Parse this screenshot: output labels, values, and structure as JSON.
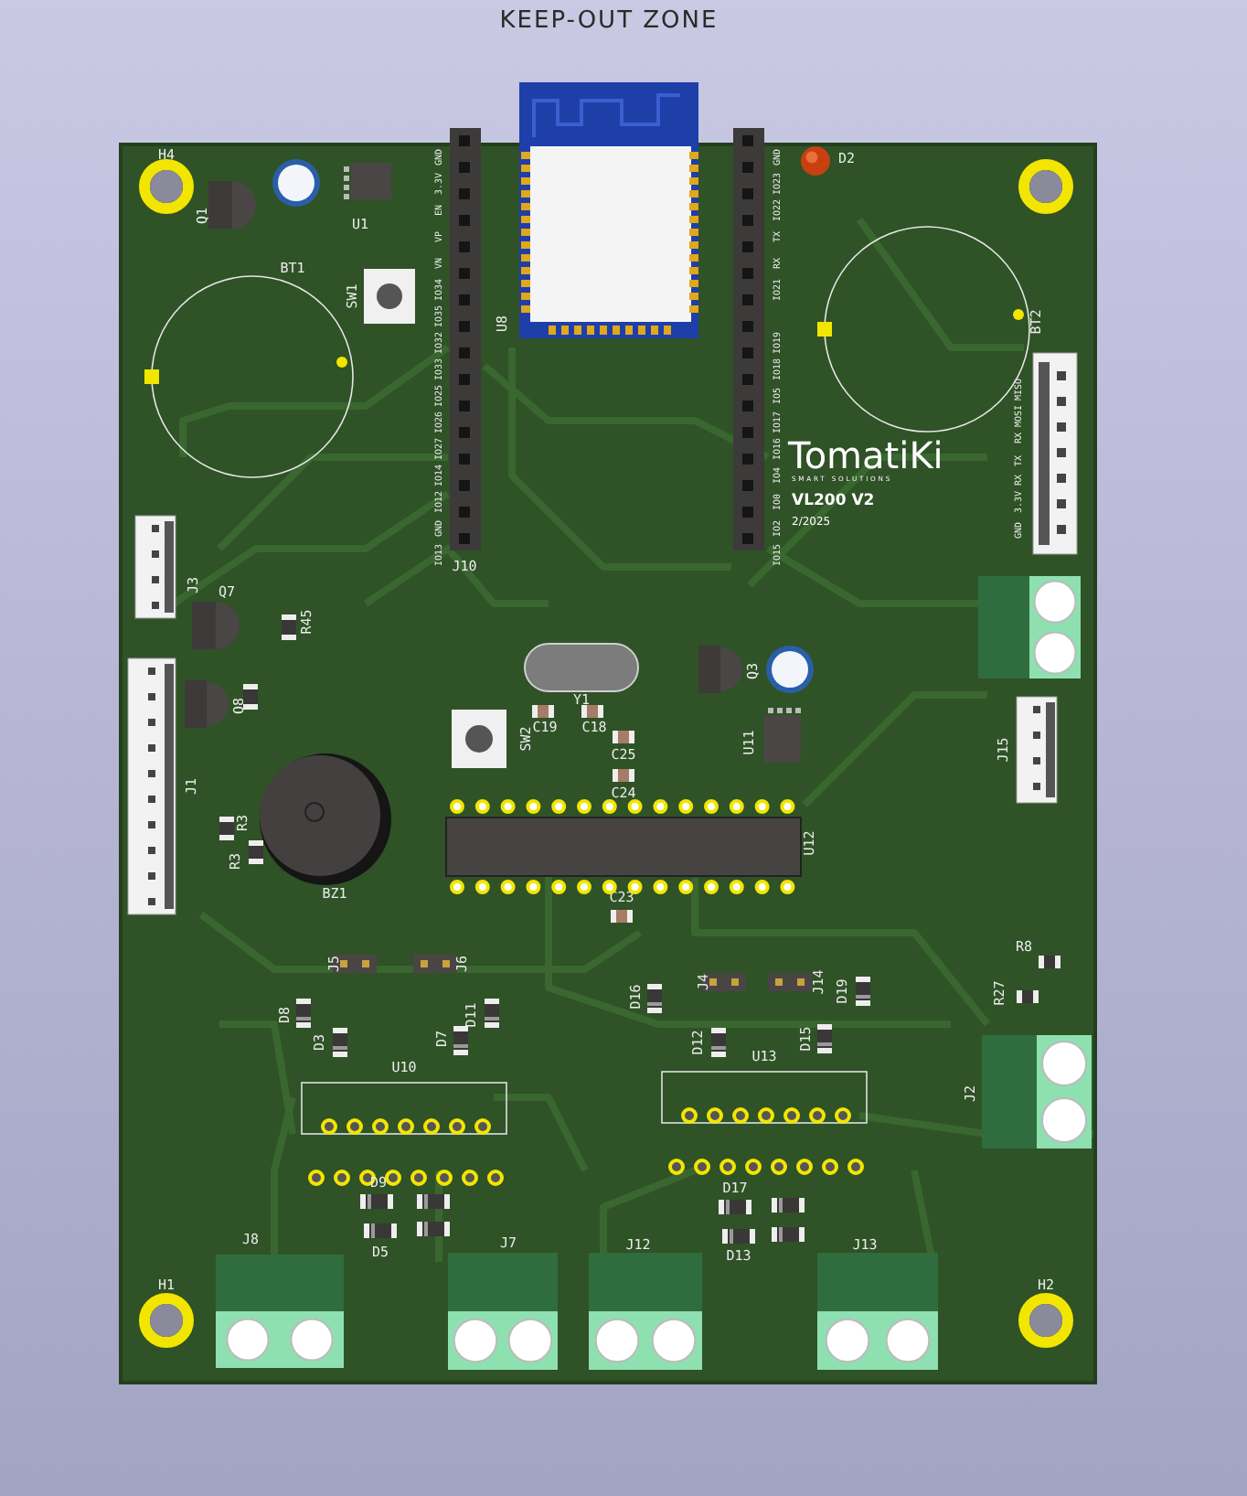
{
  "title": "KEEP-OUT ZONE",
  "logo": {
    "brand": "TomatiKi",
    "tagline": "SMART SOLUTIONS",
    "model": "VL200 V2",
    "date": "2/2025"
  },
  "module": {
    "ref": "U8"
  },
  "header_left": {
    "ref": "J10",
    "pin_labels": [
      "GND",
      "3.3V",
      "EN",
      "VP",
      "VN",
      "IO34",
      "IO35",
      "IO32",
      "IO33",
      "IO25",
      "IO26",
      "IO27",
      "IO14",
      "IO12",
      "GND",
      "IO13"
    ]
  },
  "header_right": {
    "pin_labels": [
      "GND",
      "IO23",
      "IO22",
      "TX",
      "RX",
      "IO21",
      "IO19",
      "IO18",
      "IO5",
      "IO17",
      "IO16",
      "IO4",
      "IO0",
      "IO2",
      "IO15"
    ]
  },
  "side_connector": {
    "pin_labels": [
      "MISO",
      "RX MOSI",
      "TX",
      "3.3V RX",
      "GND"
    ]
  },
  "components": [
    {
      "kind": "hole",
      "ref": "H4"
    },
    {
      "kind": "hole",
      "ref": "H1"
    },
    {
      "kind": "hole",
      "ref": "H2"
    },
    {
      "kind": "hole"
    },
    {
      "kind": "transistor",
      "ref": "Q1"
    },
    {
      "kind": "ecap"
    },
    {
      "kind": "soic",
      "ref": "U1"
    },
    {
      "kind": "battery",
      "ref": "BT1"
    },
    {
      "kind": "button",
      "ref": "SW1"
    },
    {
      "kind": "battery",
      "ref": "BT2"
    },
    {
      "kind": "led",
      "ref": "D2"
    },
    {
      "kind": "jst",
      "ref": "J3"
    },
    {
      "kind": "transistor",
      "ref": "Q7"
    },
    {
      "kind": "resistor",
      "ref": "R45"
    },
    {
      "kind": "jst",
      "ref": "J1"
    },
    {
      "kind": "transistor",
      "ref": "Q8"
    },
    {
      "kind": "resistor"
    },
    {
      "kind": "resistor",
      "ref": "R3"
    },
    {
      "kind": "resistor",
      "ref": "R3"
    },
    {
      "kind": "buzzer",
      "ref": "BZ1"
    },
    {
      "kind": "button",
      "ref": "SW2"
    },
    {
      "kind": "crystal",
      "ref": "Y1"
    },
    {
      "kind": "capacitor",
      "ref": "C19"
    },
    {
      "kind": "capacitor",
      "ref": "C18"
    },
    {
      "kind": "capacitor",
      "ref": "C25"
    },
    {
      "kind": "capacitor",
      "ref": "C24"
    },
    {
      "kind": "capacitor",
      "ref": "C23"
    },
    {
      "kind": "transistor",
      "ref": "Q3"
    },
    {
      "kind": "ecap"
    },
    {
      "kind": "soic",
      "ref": "U11"
    },
    {
      "kind": "dip",
      "ref": "U12"
    },
    {
      "kind": "terminal"
    },
    {
      "kind": "jst",
      "ref": "J15"
    },
    {
      "kind": "terminal",
      "ref": "J2"
    },
    {
      "kind": "resistor",
      "ref": "R8"
    },
    {
      "kind": "resistor",
      "ref": "R27"
    },
    {
      "kind": "jumper",
      "ref": "J5"
    },
    {
      "kind": "jumper",
      "ref": "J6"
    },
    {
      "kind": "jumper",
      "ref": "J4"
    },
    {
      "kind": "jumper",
      "ref": "J14"
    },
    {
      "kind": "diode",
      "ref": "D8"
    },
    {
      "kind": "diode",
      "ref": "D3"
    },
    {
      "kind": "diode",
      "ref": "D7"
    },
    {
      "kind": "diode",
      "ref": "D11"
    },
    {
      "kind": "diode",
      "ref": "D16"
    },
    {
      "kind": "diode",
      "ref": "D12"
    },
    {
      "kind": "diode",
      "ref": "D15"
    },
    {
      "kind": "diode",
      "ref": "D19"
    },
    {
      "kind": "sip",
      "ref": "U10"
    },
    {
      "kind": "sip",
      "ref": "U13"
    },
    {
      "kind": "diode",
      "ref": "D9"
    },
    {
      "kind": "diode"
    },
    {
      "kind": "diode",
      "ref": "D5"
    },
    {
      "kind": "diode"
    },
    {
      "kind": "diode",
      "ref": "D17"
    },
    {
      "kind": "diode"
    },
    {
      "kind": "diode",
      "ref": "D13"
    },
    {
      "kind": "diode"
    },
    {
      "kind": "terminal",
      "ref": "J8"
    },
    {
      "kind": "terminal",
      "ref": "J7"
    },
    {
      "kind": "terminal",
      "ref": "J12"
    },
    {
      "kind": "terminal",
      "ref": "J13"
    }
  ]
}
